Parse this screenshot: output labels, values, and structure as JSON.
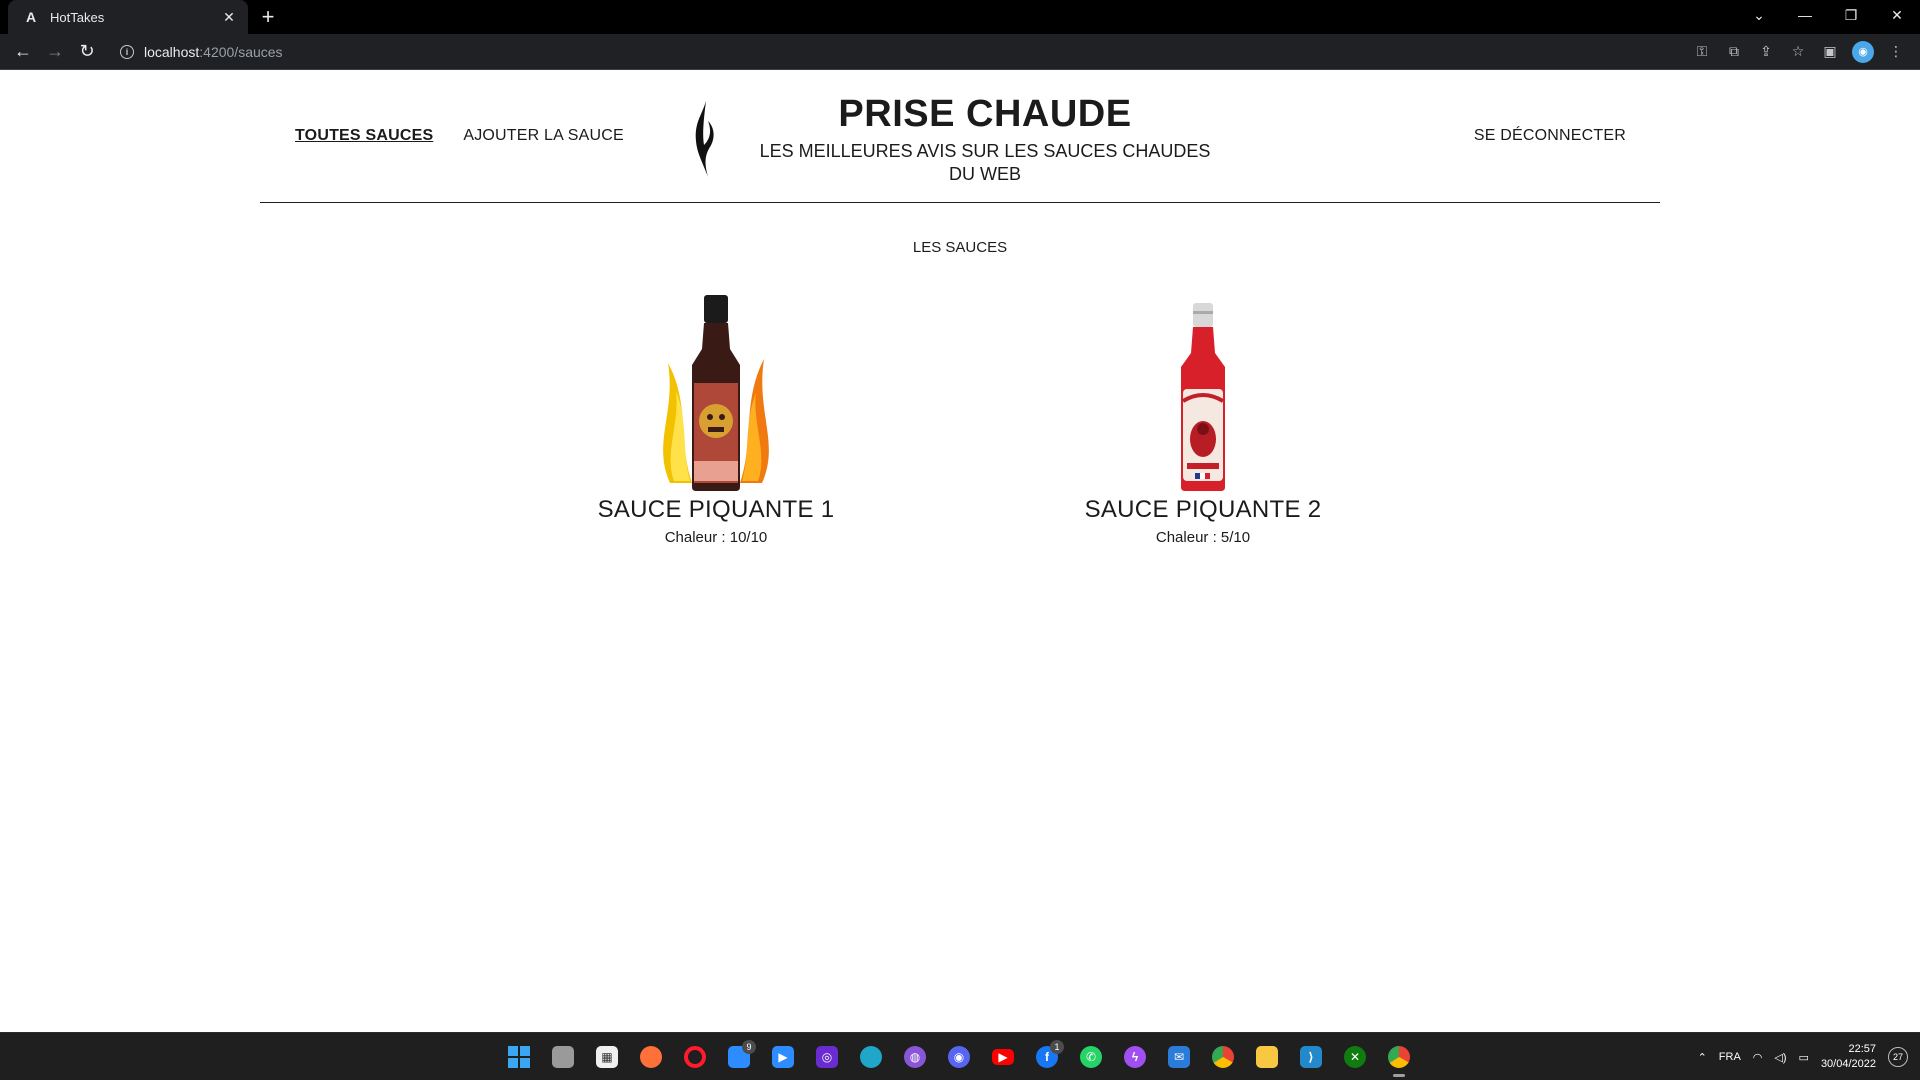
{
  "browser": {
    "tab_title": "HotTakes",
    "tab_favicon": "A",
    "url_host": "localhost",
    "url_path": ":4200/sauces",
    "icons": [
      "back-icon",
      "forward-icon",
      "reload-icon",
      "info-icon",
      "key-icon",
      "translate-icon",
      "share-icon",
      "star-icon",
      "sidepanel-icon",
      "profile-icon",
      "menu-icon"
    ]
  },
  "header": {
    "nav_all": "TOUTES SAUCES",
    "nav_add": "AJOUTER LA SAUCE",
    "title": "PRISE CHAUDE",
    "subtitle": "LES MEILLEURES AVIS SUR LES SAUCES CHAUDES DU WEB",
    "logout": "SE DÉCONNECTER"
  },
  "section_title": "LES SAUCES",
  "sauces": [
    {
      "name": "SAUCE PIQUANTE 1",
      "heat": "Chaleur : 10/10"
    },
    {
      "name": "SAUCE PIQUANTE 2",
      "heat": "Chaleur : 5/10"
    }
  ],
  "taskbar": {
    "apps": [
      "windows-start",
      "task-view",
      "store",
      "firefox",
      "opera",
      "windows-app",
      "zoom",
      "app-icon",
      "edge",
      "github",
      "discord",
      "youtube",
      "facebook",
      "whatsapp",
      "messenger",
      "mail",
      "chrome",
      "file-explorer",
      "vscode",
      "xbox",
      "chrome-active"
    ],
    "badge_9": "9",
    "badge_1": "1",
    "language": "FRA",
    "time": "22:57",
    "date": "30/04/2022",
    "notifications": "27"
  }
}
